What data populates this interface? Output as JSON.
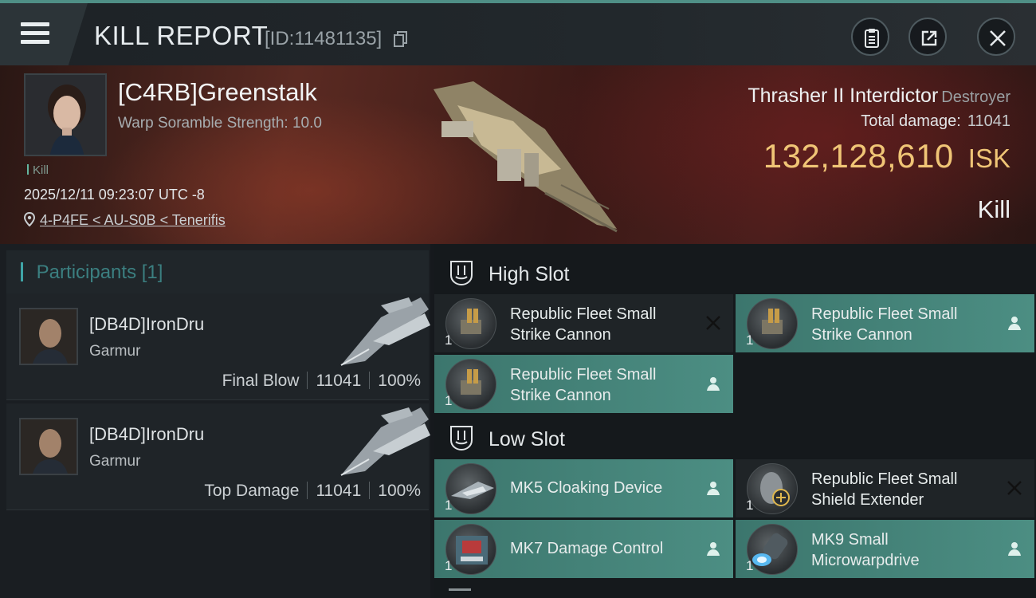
{
  "header": {
    "title": "KILL REPORT",
    "report_id": "[ID:11481135]",
    "menu_icon": "hamburger-menu-icon",
    "actions": [
      "clipboard-icon",
      "share-icon",
      "close-icon"
    ]
  },
  "victim": {
    "name": "[C4RB]Greenstalk",
    "attribute": "Warp Soramble Strength: 10.0",
    "tag": "Kill",
    "timestamp": "2025/12/11 09:23:07 UTC -8",
    "location": "4-P4FE < AU-S0B < Tenerifis",
    "ship_name": "Thrasher II Interdictor",
    "ship_class": "Destroyer",
    "total_damage_label": "Total damage:",
    "total_damage": "11041",
    "isk_value": "132,128,610",
    "isk_unit": "ISK",
    "result": "Kill"
  },
  "participants": {
    "title": "Participants",
    "count": "[1]",
    "items": [
      {
        "name": "[DB4D]IronDru",
        "ship": "Garmur",
        "role": "Final Blow",
        "damage": "11041",
        "percent": "100%"
      },
      {
        "name": "[DB4D]IronDru",
        "ship": "Garmur",
        "role": "Top Damage",
        "damage": "11041",
        "percent": "100%"
      }
    ]
  },
  "fitting": {
    "high_slot": {
      "label": "High Slot",
      "modules": [
        {
          "name": "Republic Fleet Small Strike Cannon",
          "qty": "1",
          "state": "dropped",
          "status_icon": "destroyed-x-icon",
          "icon": "cannon-turret-icon"
        },
        {
          "name": "Republic Fleet Small Strike Cannon",
          "qty": "1",
          "state": "fitted",
          "status_icon": "person-icon",
          "icon": "cannon-turret-icon"
        },
        {
          "name": "Republic Fleet Small Strike Cannon",
          "qty": "1",
          "state": "fitted",
          "status_icon": "person-icon",
          "icon": "cannon-turret-icon"
        }
      ]
    },
    "low_slot": {
      "label": "Low Slot",
      "modules": [
        {
          "name": "MK5 Cloaking Device",
          "qty": "1",
          "state": "fitted",
          "status_icon": "person-icon",
          "icon": "cloaking-device-icon"
        },
        {
          "name": "Republic Fleet Small Shield Extender",
          "qty": "1",
          "state": "dropped",
          "status_icon": "destroyed-x-icon",
          "icon": "shield-extender-icon"
        },
        {
          "name": "MK7 Damage Control",
          "qty": "1",
          "state": "fitted",
          "status_icon": "person-icon",
          "icon": "damage-control-icon"
        },
        {
          "name": "MK9 Small Microwarpdrive",
          "qty": "1",
          "state": "fitted",
          "status_icon": "person-icon",
          "icon": "microwarpdrive-icon"
        }
      ]
    }
  },
  "colors": {
    "accent_teal": "#4c8e83",
    "isk_gold": "#f0c576",
    "participants_title": "#3b7f80"
  }
}
